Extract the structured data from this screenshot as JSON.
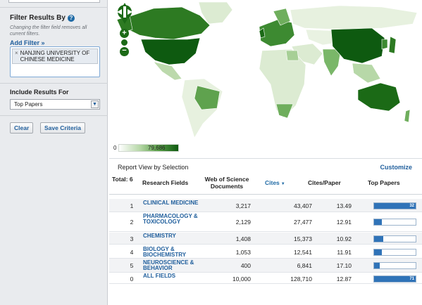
{
  "sidebar": {
    "title": "Filter Results By",
    "note": "Changing the filter field removes all current filters.",
    "add_filter": "Add Filter »",
    "filter_tag": "NANJING UNIVERSITY OF CHINESE MEDICINE",
    "include_label": "Include Results For",
    "include_value": "Top Papers",
    "clear_label": "Clear",
    "save_label": "Save Criteria"
  },
  "legend": {
    "min": "0",
    "max": "79,686"
  },
  "report": {
    "title": "Report View by Selection",
    "customize": "Customize",
    "total_label": "Total: 6",
    "columns": {
      "field": "Research Fields",
      "docs": "Web of Science Documents",
      "cites": "Cites",
      "cpp": "Cites/Paper",
      "top": "Top Papers"
    },
    "rows": [
      {
        "rank": "1",
        "field": "CLINICAL MEDICINE",
        "docs": "3,217",
        "cites": "43,407",
        "cpp": "13.49",
        "top": "32",
        "fill": 1.0
      },
      {
        "rank": "2",
        "field": "PHARMACOLOGY & TOXICOLOGY",
        "docs": "2,129",
        "cites": "27,477",
        "cpp": "12.91",
        "top": "6",
        "fill": 0.19
      },
      {
        "rank": "3",
        "field": "CHEMISTRY",
        "docs": "1,408",
        "cites": "15,373",
        "cpp": "10.92",
        "top": "7",
        "fill": 0.22
      },
      {
        "rank": "4",
        "field": "BIOLOGY & BIOCHEMISTRY",
        "docs": "1,053",
        "cites": "12,541",
        "cpp": "11.91",
        "top": "6",
        "fill": 0.19
      },
      {
        "rank": "5",
        "field": "NEUROSCIENCE & BEHAVIOR",
        "docs": "400",
        "cites": "6,841",
        "cpp": "17.10",
        "top": "4",
        "fill": 0.13
      },
      {
        "rank": "0",
        "field": "ALL FIELDS",
        "docs": "10,000",
        "cites": "128,710",
        "cpp": "12.87",
        "top": "71",
        "fill": 1.0
      }
    ]
  },
  "colors": {
    "link": "#1f5e9c",
    "bar": "#2f73b8",
    "map_dark": "#0e5a10",
    "map_light": "#dcebd2"
  }
}
